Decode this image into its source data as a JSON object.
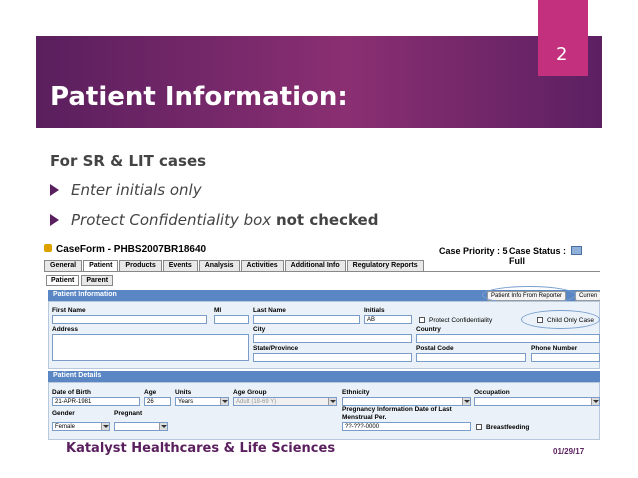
{
  "slide": {
    "number": "2",
    "title": "Patient Information:",
    "subheading": "For SR & LIT cases",
    "bullet1": "Enter initials only",
    "bullet2_prefix": "Protect Confidentiality box ",
    "bullet2_bold": "not checked",
    "footer_company": "Katalyst Healthcares & Life Sciences",
    "footer_date": "01/29/17"
  },
  "colors": {
    "banner": "#6e2868",
    "accent": "#c2307e",
    "section_header": "#5a86c4"
  },
  "app": {
    "window_title": "CaseForm - PHBS2007BR18640",
    "case_priority": "Case Priority : 5",
    "case_status_label": "Case Status :",
    "case_status_value": "Full",
    "tabs": [
      "General",
      "Patient",
      "Products",
      "Events",
      "Analysis",
      "Activities",
      "Additional Info",
      "Regulatory Reports"
    ],
    "active_tab": "Patient",
    "subtabs": [
      "Patient",
      "Parent"
    ],
    "patient_info": {
      "header": "Patient Information",
      "btn_patient_info_from_reporter": "Patient Info From Reporter",
      "btn_current": "Curren",
      "first_name_label": "First Name",
      "mi_label": "MI",
      "last_name_label": "Last Name",
      "initials_label": "Initials",
      "initials_value": "AB",
      "protect_conf_label": "Protect Confidentiality",
      "child_only_label": "Child Only Case",
      "address_label": "Address",
      "city_label": "City",
      "country_label": "Country",
      "state_label": "State/Province",
      "postal_label": "Postal Code",
      "phone_label": "Phone Number"
    },
    "patient_details": {
      "header": "Patient Details",
      "dob_label": "Date of Birth",
      "dob_value": "21-APR-1981",
      "age_label": "Age",
      "age_value": "26",
      "units_label": "Units",
      "units_value": "Years",
      "age_group_label": "Age Group",
      "age_group_value": "Adult (18-69 Y)",
      "ethnicity_label": "Ethnicity",
      "occupation_label": "Occupation",
      "gender_label": "Gender",
      "gender_value": "Female",
      "pregnant_label": "Pregnant",
      "preg_date_label": "Pregnancy Information Date of Last Menstrual Per.",
      "preg_date_value": "??-???-0000",
      "breastfeeding_label": "Breastfeeding"
    }
  }
}
